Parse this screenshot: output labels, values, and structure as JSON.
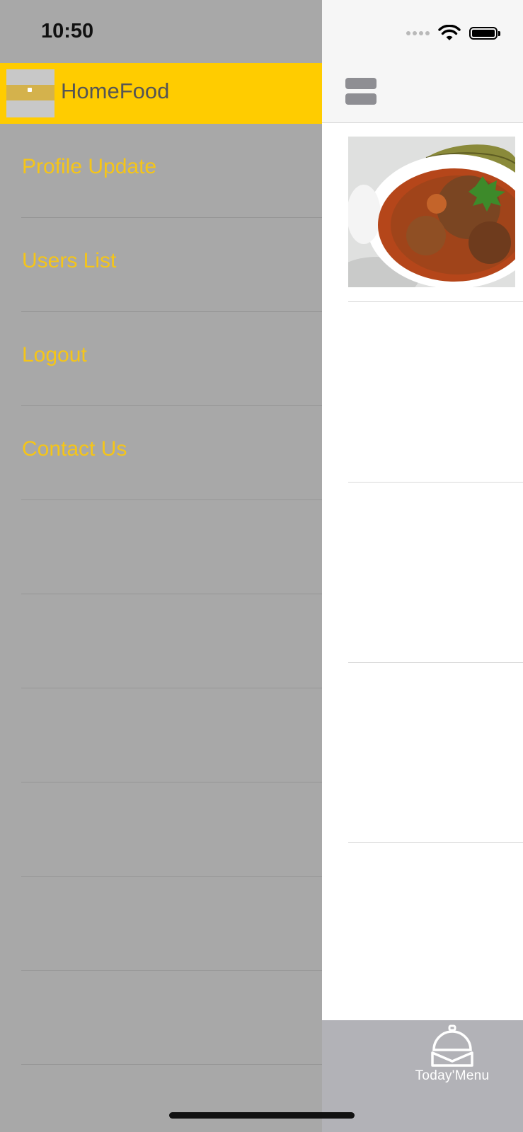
{
  "status_bar": {
    "time": "10:50"
  },
  "drawer": {
    "app_name": "HomeFood",
    "items": [
      {
        "label": "Profile Update"
      },
      {
        "label": "Users List"
      },
      {
        "label": "Logout"
      },
      {
        "label": "Contact Us"
      },
      {
        "label": ""
      },
      {
        "label": ""
      },
      {
        "label": ""
      },
      {
        "label": ""
      },
      {
        "label": ""
      },
      {
        "label": ""
      }
    ]
  },
  "tabbar": {
    "today_menu_label": "Today'Menu"
  },
  "icons": {
    "menu": "hamburger-icon",
    "tab": "cloche-icon",
    "logo": "homefood-logo"
  },
  "colors": {
    "accent": "#ffcc00",
    "drawer_item_text": "#f5c518",
    "drawer_bg": "#a8a8a8",
    "tabbar_bg": "#b2b2b7"
  }
}
